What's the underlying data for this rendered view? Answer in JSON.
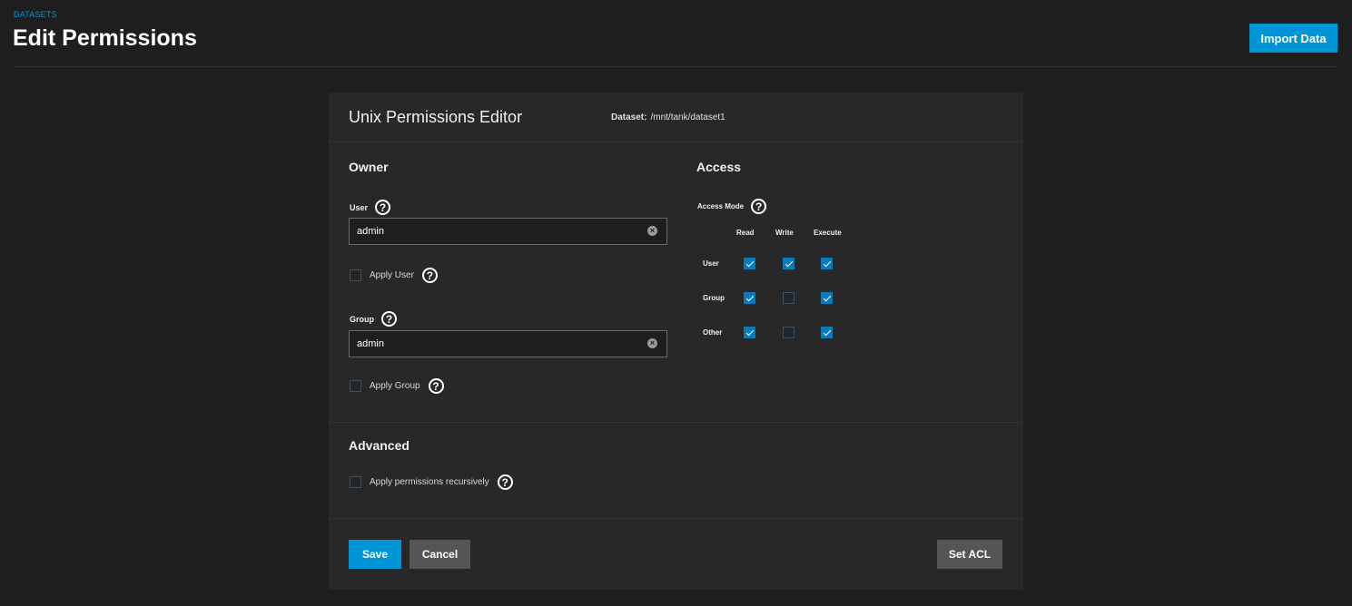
{
  "breadcrumb": "DATASETS",
  "page_title": "Edit Permissions",
  "header": {
    "import_label": "Import Data"
  },
  "editor": {
    "title": "Unix Permissions Editor",
    "dataset_label": "Dataset:",
    "dataset_path": "/mnt/tank/dataset1"
  },
  "owner": {
    "title": "Owner",
    "user_label": "User",
    "user_value": "admin",
    "apply_user_label": "Apply User",
    "apply_user_checked": false,
    "group_label": "Group",
    "group_value": "admin",
    "apply_group_label": "Apply Group",
    "apply_group_checked": false
  },
  "access": {
    "title": "Access",
    "mode_label": "Access Mode",
    "columns": [
      "Read",
      "Write",
      "Execute"
    ],
    "rows": [
      {
        "label": "User",
        "values": [
          true,
          true,
          true
        ]
      },
      {
        "label": "Group",
        "values": [
          true,
          false,
          true
        ]
      },
      {
        "label": "Other",
        "values": [
          true,
          false,
          true
        ]
      }
    ]
  },
  "advanced": {
    "title": "Advanced",
    "recursive_label": "Apply permissions recursively",
    "recursive_checked": false
  },
  "actions": {
    "save": "Save",
    "cancel": "Cancel",
    "set_acl": "Set ACL"
  },
  "colors": {
    "accent": "#0095d5",
    "background": "#1e1e1e",
    "card": "#282828",
    "secondary_button": "#555555"
  }
}
